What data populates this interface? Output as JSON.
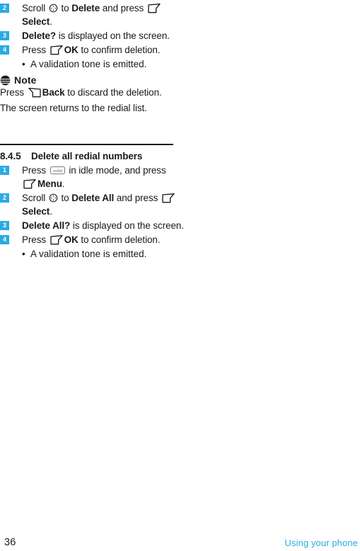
{
  "page": {
    "number": "36",
    "footer_label": "Using your phone",
    "accent_color": "#29abe2",
    "text_color": "#1a1a1a"
  },
  "block_delete_one": {
    "steps": [
      {
        "num": "2",
        "pre": "Scroll ",
        "icon1": "nav-key-icon",
        "mid": " to ",
        "bold1": "Delete",
        "mid2": " and press ",
        "icon2": "softkey-left-icon",
        "bold2": "Select",
        "post": "."
      },
      {
        "num": "3",
        "bold1": "Delete?",
        "post": " is displayed on the screen."
      },
      {
        "num": "4",
        "pre": "Press ",
        "icon1": "softkey-left-icon",
        "bold1": "OK",
        "post": " to confirm deletion."
      }
    ],
    "bullet": {
      "dot": "•",
      "text": "A validation tone is emitted."
    }
  },
  "note": {
    "icon": "note-icon",
    "heading": "Note",
    "line1_pre": "Press ",
    "line1_icon": "softkey-right-icon",
    "line1_bold": "Back",
    "line1_post": " to discard the deletion.",
    "line2": "The screen returns to the redial list."
  },
  "section": {
    "number": "8.4.5",
    "title": "Delete all redial numbers",
    "steps": [
      {
        "num": "1",
        "pre": "Press ",
        "icon1": "redial-key-icon",
        "icon1_label": "redial",
        "mid": " in idle mode, and press ",
        "icon2": "softkey-left-icon",
        "bold1": "Menu",
        "post": "."
      },
      {
        "num": "2",
        "pre": "Scroll ",
        "icon1": "nav-key-icon",
        "mid": " to ",
        "bold1": "Delete All",
        "mid2": " and press ",
        "icon2": "softkey-left-icon",
        "bold2": "Select",
        "post": "."
      },
      {
        "num": "3",
        "bold1": "Delete All?",
        "post": " is displayed on the screen."
      },
      {
        "num": "4",
        "pre": "Press ",
        "icon1": "softkey-left-icon",
        "bold1": "OK",
        "post": " to confirm deletion."
      }
    ],
    "bullet": {
      "dot": "•",
      "text": "A validation tone is emitted."
    }
  }
}
